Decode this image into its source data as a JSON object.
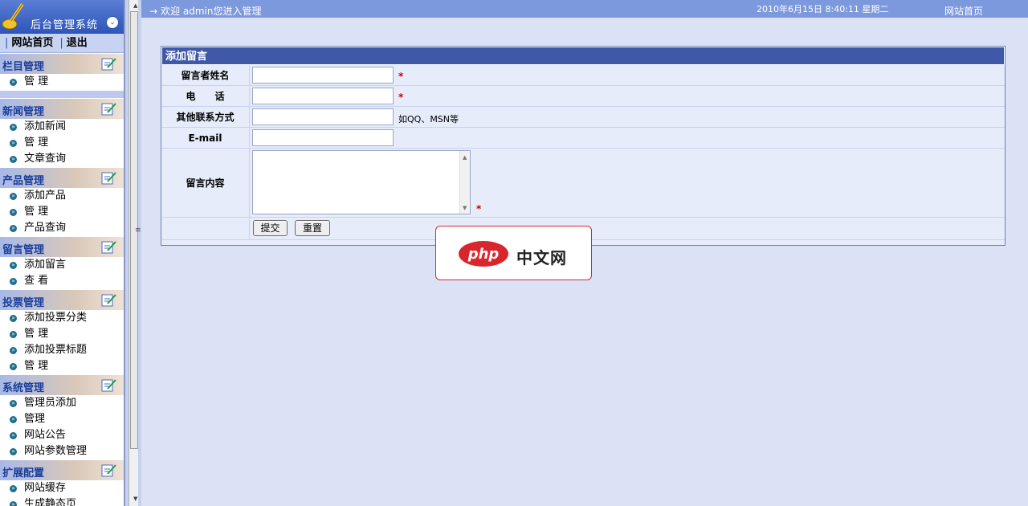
{
  "sidebar": {
    "title": "后台管理系统",
    "quicklinks": [
      "网站首页",
      "退出"
    ],
    "groups": [
      {
        "title": "栏目管理",
        "items": [
          "管 理"
        ]
      },
      {
        "title": "新闻管理",
        "items": [
          "添加新闻",
          "管 理",
          "文章查询"
        ]
      },
      {
        "title": "产品管理",
        "items": [
          "添加产品",
          "管 理",
          "产品查询"
        ]
      },
      {
        "title": "留言管理",
        "items": [
          "添加留言",
          "查 看"
        ]
      },
      {
        "title": "投票管理",
        "items": [
          "添加投票分类",
          "管 理",
          "添加投票标题",
          "管 理"
        ]
      },
      {
        "title": "系统管理",
        "items": [
          "管理员添加",
          "管理",
          "网站公告",
          "网站参数管理"
        ]
      },
      {
        "title": "扩展配置",
        "items": [
          "网站缓存",
          "生成静态页"
        ]
      }
    ]
  },
  "topbar": {
    "arrow": "→",
    "welcome": "欢迎 admin您进入管理",
    "datetime": "2010年6月15日 8:40:11 星期二",
    "home_link": "网站首页"
  },
  "form": {
    "title": "添加留言",
    "name_label": "留言者姓名",
    "phone_label": "电　　话",
    "other_label": "其他联系方式",
    "other_hint": "如QQ、MSN等",
    "email_label": "E-mail",
    "content_label": "留言内容",
    "required_mark": "*",
    "submit_label": "提交",
    "reset_label": "重置",
    "values": {
      "name": "",
      "phone": "",
      "other": "",
      "email": "",
      "content": ""
    }
  },
  "watermark": {
    "logo_text": "php",
    "brand": "中文网"
  },
  "colors": {
    "topbar": "#7d99dd",
    "panel_header": "#4058a8",
    "required": "#cc0000",
    "watermark_border": "#d9262c"
  }
}
